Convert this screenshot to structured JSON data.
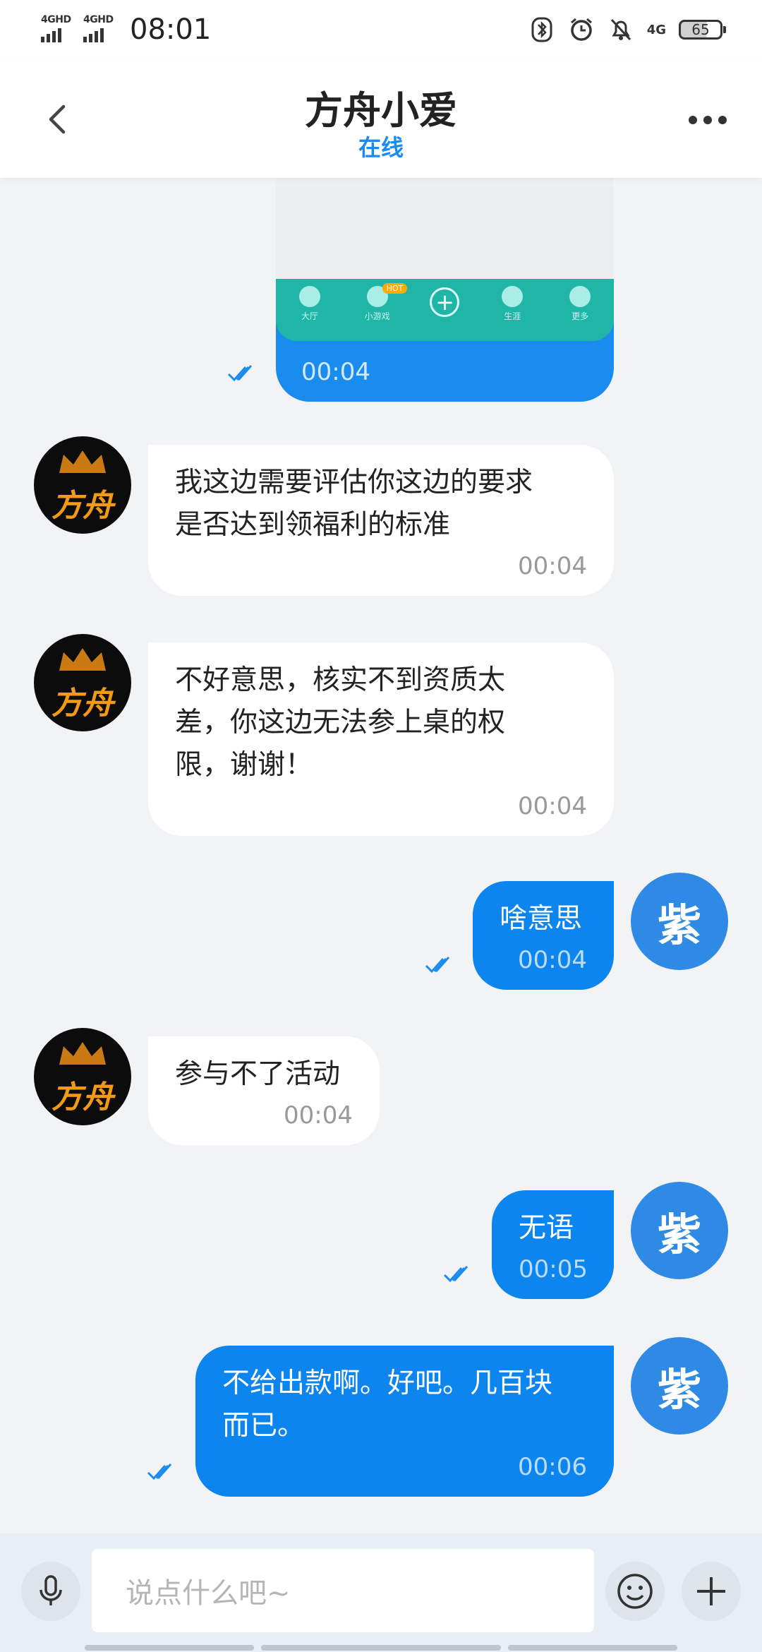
{
  "status_bar": {
    "signal_1": "4GHD",
    "signal_2": "4GHD",
    "time": "08:01",
    "network": "4G",
    "battery": "65"
  },
  "header": {
    "title": "方舟小爱",
    "status": "在线"
  },
  "image_message": {
    "tabs": [
      "大厅",
      "小游戏",
      "",
      "生涯",
      "更多"
    ],
    "hot_badge": "HOT",
    "time": "00:04"
  },
  "messages": [
    {
      "sender": "agent",
      "text": "我这边需要评估你这边的要求\n是否达到领福利的标准",
      "time": "00:04",
      "avatar_text": "方舟"
    },
    {
      "sender": "agent",
      "text": "不好意思，核实不到资质太\n差，你这边无法参上桌的权\n限，谢谢！",
      "time": "00:04",
      "avatar_text": "方舟"
    },
    {
      "sender": "user",
      "text": "啥意思",
      "time": "00:04",
      "avatar_text": "紫"
    },
    {
      "sender": "agent",
      "text": "参与不了活动",
      "time": "00:04",
      "avatar_text": "方舟"
    },
    {
      "sender": "user",
      "text": "无语",
      "time": "00:05",
      "avatar_text": "紫"
    },
    {
      "sender": "user",
      "text": "不给出款啊。好吧。几百块\n而已。",
      "time": "00:06",
      "avatar_text": "紫"
    }
  ],
  "input_bar": {
    "placeholder": "说点什么吧~"
  },
  "colors": {
    "accent": "#1a8cf0",
    "outgoing_bubble": "#0d85ee",
    "user_avatar": "#2f8ae6",
    "background": "#f2f3f5"
  }
}
